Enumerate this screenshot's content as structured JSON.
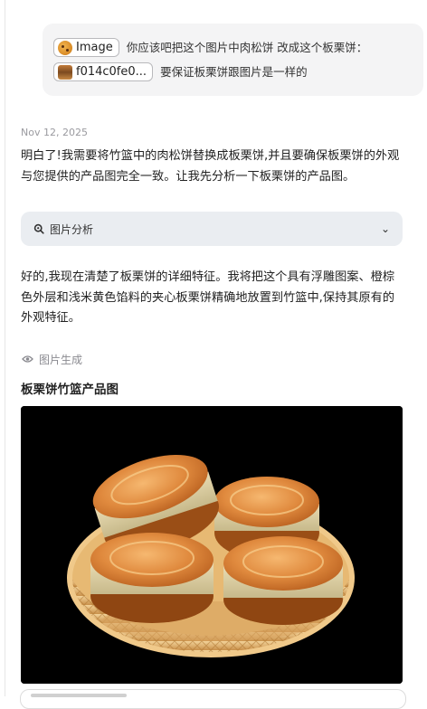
{
  "user_message": {
    "chip1_label": "Image",
    "line1_text": "你应该吧把这个图片中肉松饼 改成这个板栗饼：",
    "chip2_label": "f014c0fe0...",
    "line2_text": "要保证板栗饼跟图片是一样的"
  },
  "assistant": {
    "date": "Nov 12, 2025",
    "intro": "明白了!我需要将竹篮中的肉松饼替换成板栗饼,并且要确保板栗饼的外观与您提供的产品图完全一致。让我先分析一下板栗饼的产品图。",
    "analysis_label": "图片分析",
    "analysis_chevron": "⌄",
    "detail": "好的,我现在清楚了板栗饼的详细特征。我将把这个具有浮雕图案、橙棕色外层和浅米黄色馅料的夹心板栗饼精确地放置到竹篮中,保持其原有的外观特征。",
    "generation_label": "图片生成",
    "image_title": "板栗饼竹篮产品图"
  },
  "colors": {
    "bubble_bg": "#f4f4f5",
    "analysis_bg": "#eaedf1",
    "muted_text": "#9a9a9f"
  }
}
